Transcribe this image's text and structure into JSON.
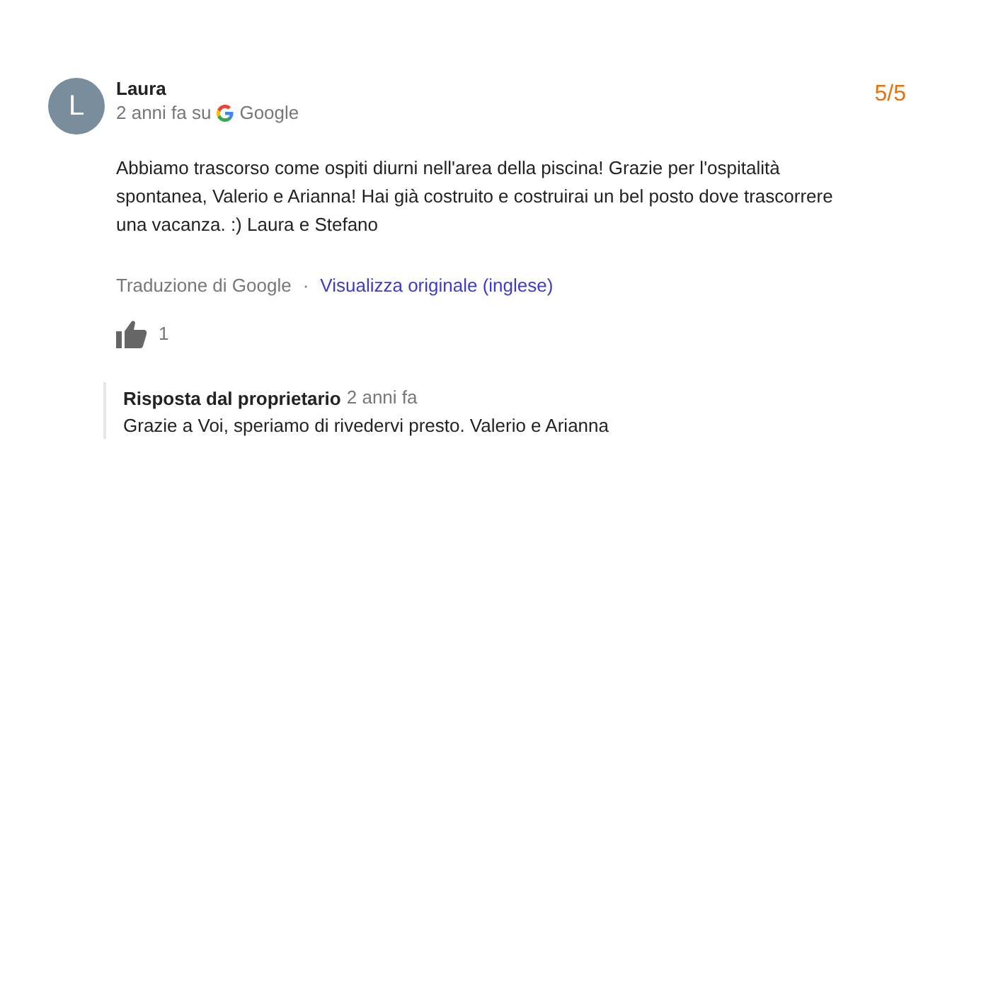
{
  "review": {
    "avatar_letter": "L",
    "author": "Laura",
    "time": "2 anni fa su",
    "source": "Google",
    "rating": "5/5",
    "text": "Abbiamo trascorso come ospiti diurni nell'area della piscina! Grazie per l'ospitalità spontanea, Valerio e Arianna! Hai già costruito e costruirai un bel posto dove trascorrere una vacanza. :) Laura e Stefano",
    "translation_note": "Traduzione di Google",
    "separator": "·",
    "original_link": "Visualizza originale (inglese)",
    "likes": "1"
  },
  "owner_reply": {
    "title": "Risposta dal proprietario",
    "time": "2 anni fa",
    "text": "Grazie a Voi, speriamo di rivedervi presto. Valerio e Arianna"
  }
}
